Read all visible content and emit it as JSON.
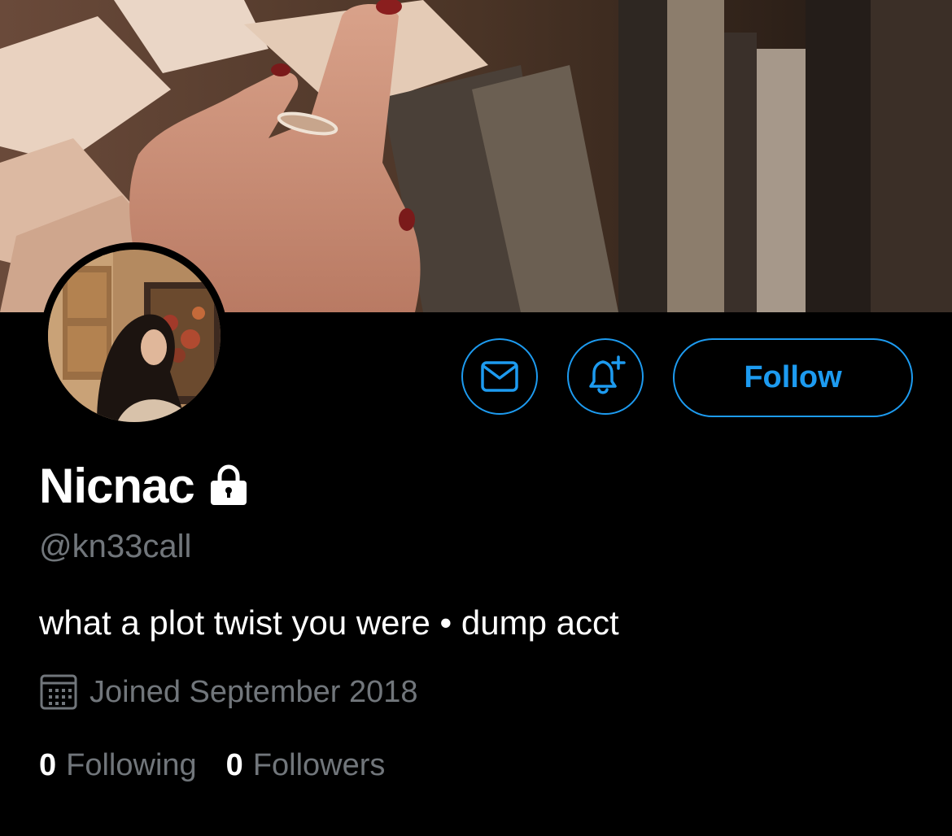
{
  "profile": {
    "display_name": "Nicnac",
    "handle": "@kn33call",
    "bio": "what a plot twist you were • dump acct",
    "joined": "Joined September 2018",
    "protected": true
  },
  "actions": {
    "message_icon": "envelope-icon",
    "notify_icon": "bell-plus-icon",
    "follow_label": "Follow"
  },
  "stats": {
    "following_count": "0",
    "following_label": "Following",
    "followers_count": "0",
    "followers_label": "Followers"
  },
  "colors": {
    "accent": "#1d9bf0",
    "background": "#000000",
    "secondary_text": "#71767b",
    "primary_text": "#ffffff"
  }
}
